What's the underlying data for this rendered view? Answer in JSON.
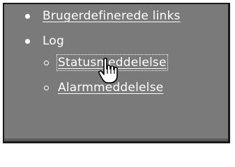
{
  "menu": {
    "items": [
      {
        "label": "Brugerdefinerede links",
        "type": "link"
      },
      {
        "label": "Log",
        "type": "text"
      }
    ],
    "subitems": [
      {
        "label": "Statusmeddelelse",
        "type": "link"
      },
      {
        "label": "Alarmmeddelelse",
        "type": "link"
      }
    ]
  },
  "icons": {
    "cursor": "hand-pointer-icon"
  }
}
